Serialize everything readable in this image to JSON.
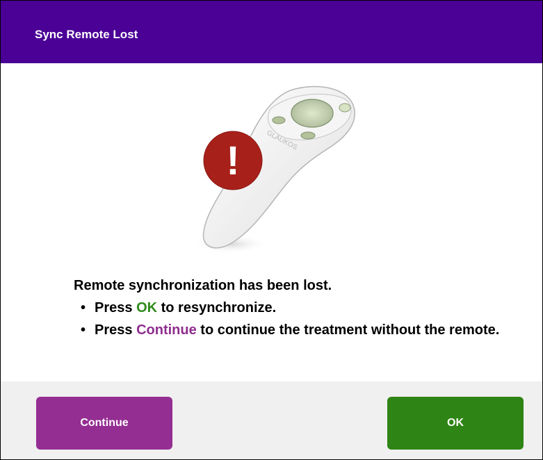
{
  "dialog": {
    "title": "Sync Remote Lost"
  },
  "illustration": {
    "name": "remote-illustration",
    "brand_text": "GLAUKOS",
    "alert_symbol": "!",
    "alert_color": "#a8201a"
  },
  "message": {
    "heading": "Remote synchronization has been lost.",
    "items": [
      {
        "bullet": "•",
        "prefix": "Press",
        "keyword": "OK",
        "suffix": "to resynchronize."
      },
      {
        "bullet": "•",
        "prefix": "Press",
        "keyword": "Continue",
        "suffix": "to continue the treatment without the remote."
      }
    ]
  },
  "buttons": {
    "continue_label": "Continue",
    "ok_label": "OK"
  },
  "colors": {
    "titlebar": "#4b0096",
    "continue": "#942e92",
    "ok": "#2e8414",
    "ok_text": "#2e8b1a",
    "continue_text": "#8e2e8e"
  }
}
